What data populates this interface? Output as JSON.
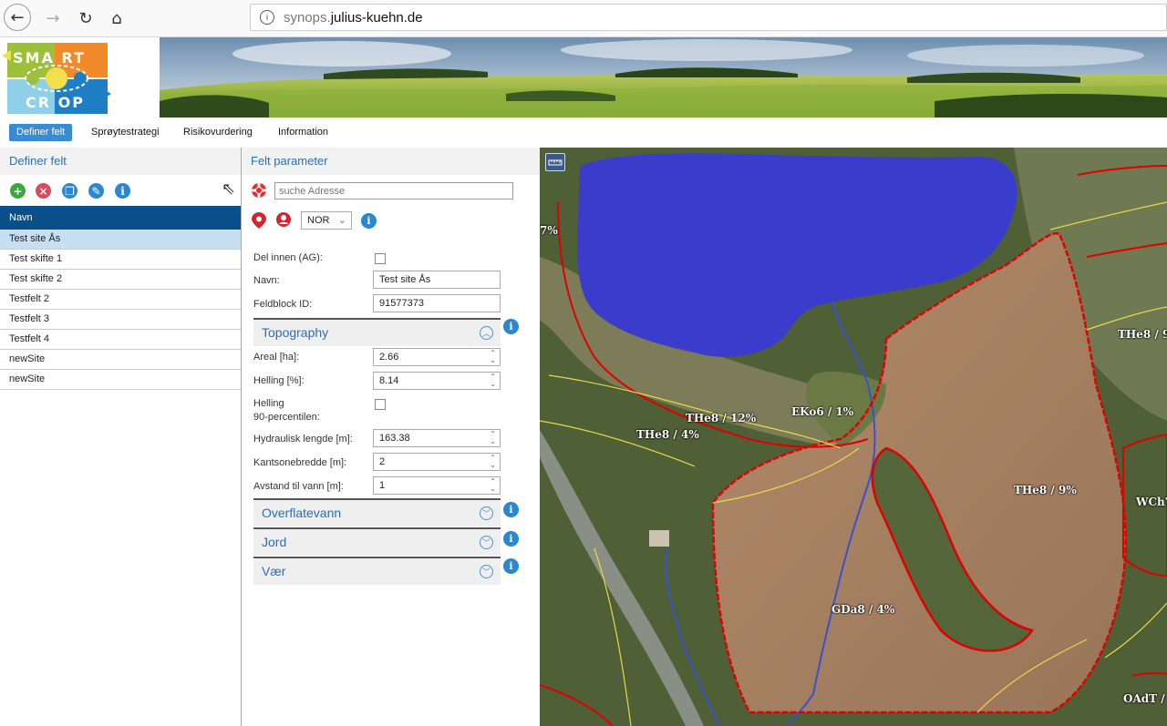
{
  "browser": {
    "url_prefix": "synops.",
    "url_domain": "julius-kuehn.de"
  },
  "logo": {
    "line1": "SMA RT",
    "line2": "CR OP"
  },
  "menu": [
    {
      "label": "Definer felt",
      "active": true
    },
    {
      "label": "Sprøytestrategi",
      "active": false
    },
    {
      "label": "Risikovurdering",
      "active": false
    },
    {
      "label": "Information",
      "active": false
    }
  ],
  "left_panel": {
    "title": "Definer felt",
    "list_header": "Navn",
    "rows": [
      "Test site Ås",
      "Test skifte 1",
      "Test skifte 2",
      "Testfelt 2",
      "Testfelt 3",
      "Testfelt 4",
      "newSite",
      "newSite"
    ],
    "selected_index": 0
  },
  "mid_panel": {
    "title": "Felt parameter",
    "address_placeholder": "suche Adresse",
    "country_value": "NOR",
    "del_innen_label": "Del innen (AG):",
    "navn_label": "Navn:",
    "navn_value": "Test site Ås",
    "feldblock_label": "Feldblock ID:",
    "feldblock_value": "91577373",
    "topography": {
      "title": "Topography",
      "areal_label": "Areal [ha]:",
      "areal_value": "2.66",
      "helling_label": "Helling [%]:",
      "helling_value": "8.14",
      "helling90_label_a": "Helling",
      "helling90_label_b": "90-percentilen:",
      "hydraulisk_label": "Hydraulisk lengde [m]:",
      "hydraulisk_value": "163.38",
      "kantsone_label": "Kantsonebredde [m]:",
      "kantsone_value": "2",
      "avstand_label": "Avstand til vann [m]:",
      "avstand_value": "1"
    },
    "sections": [
      "Overflatevann",
      "Jord",
      "Vær"
    ]
  },
  "map": {
    "labels": [
      "THe8 / 12%",
      "EKo6 / 1%",
      "THe8 / 4%",
      "THe8 / 9%",
      "GDa8 / 4%",
      "THe8 / 9",
      "WCh7",
      "OAdT /",
      "7%"
    ],
    "colors": {
      "water": "#3a3ccc",
      "field_boundary": "#e00000",
      "soil_boundary": "#e8d84a",
      "stream": "#3b50d0"
    }
  }
}
